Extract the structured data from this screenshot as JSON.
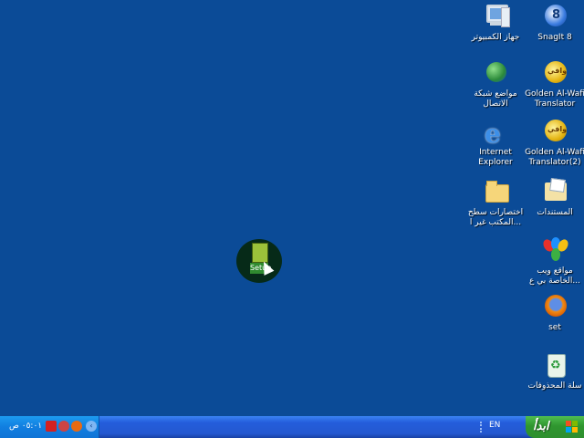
{
  "desktop": {
    "right_column": [
      {
        "id": "snagit",
        "icon": "snagit-icon",
        "label": [
          "SnagIt 8"
        ]
      },
      {
        "id": "wafi1",
        "icon": "golden-alwafi-icon",
        "label": [
          "Golden Al-Wafi",
          "Translator"
        ]
      },
      {
        "id": "wafi2",
        "icon": "golden-alwafi-icon",
        "label": [
          "Golden Al-Wafi",
          "Translator(2)"
        ]
      },
      {
        "id": "mydocs",
        "icon": "my-documents-icon",
        "label": [
          "المستندات"
        ]
      },
      {
        "id": "msn",
        "icon": "msn-icon",
        "label": [
          "مواقع ويب",
          "الخاصة بي ع..."
        ]
      },
      {
        "id": "firefox",
        "icon": "firefox-icon",
        "label": [
          "set"
        ]
      },
      {
        "id": "recycle",
        "icon": "recycle-bin-icon",
        "label": [
          "سلة المحذوفات"
        ]
      }
    ],
    "left_column": [
      {
        "id": "mycomputer",
        "icon": "my-computer-icon",
        "label": [
          "جهاز الكمبيوتر"
        ]
      },
      {
        "id": "network",
        "icon": "network-places-icon",
        "label": [
          "مواضع شبكة",
          "الاتصال"
        ]
      },
      {
        "id": "ie",
        "icon": "internet-explorer-icon",
        "label": [
          "Internet",
          "Explorer"
        ]
      },
      {
        "id": "shortcuts",
        "icon": "folder-icon",
        "label": [
          "اختصارات سطح",
          "المكتب غير ا..."
        ]
      }
    ],
    "setup": {
      "label": "Setup",
      "icon": "setup-icon"
    }
  },
  "taskbar": {
    "start_label": "ابدأ",
    "language": "EN",
    "clock": "٠٥:٠١ ص",
    "tray_icons": [
      "kaspersky-icon",
      "media-icon",
      "firefox-tray-icon"
    ]
  },
  "colors": {
    "desktop": "#0b4b97",
    "taskbar": "#245ddb",
    "start": "#2f962f"
  }
}
